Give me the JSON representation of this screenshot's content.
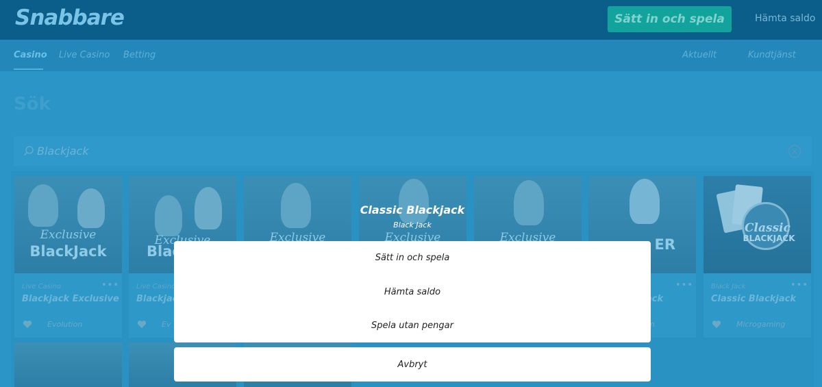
{
  "header": {
    "logo": "Snabbare",
    "deposit_button": "Sätt in och spela",
    "fetch_balance": "Hämta saldo"
  },
  "nav": {
    "left": [
      "Casino",
      "Live Casino",
      "Betting"
    ],
    "right": [
      "Aktuellt",
      "Kundtjänst"
    ]
  },
  "search": {
    "title": "Sök",
    "query": "Blackjack"
  },
  "cards": [
    {
      "overlay": "Exclusive",
      "overlay2": "BlackJack",
      "category": "Live Casino",
      "title": "Blackjack Exclusive",
      "provider": "Evolution"
    },
    {
      "overlay": "Exclusive",
      "overlay2": "Blac",
      "category": "Live Casino",
      "title": "Blackjac",
      "provider": "Ev"
    },
    {
      "overlay": "Exclusive",
      "overlay2": "",
      "category": "",
      "title": "",
      "provider": ""
    },
    {
      "overlay": "Exclusive",
      "overlay2": "",
      "category": "",
      "title": "",
      "provider": ""
    },
    {
      "overlay": "Exclusive",
      "overlay2": "",
      "category": "",
      "title": "",
      "provider": ""
    },
    {
      "overlay": "",
      "overlay2": "ER",
      "category": "",
      "title": "ack",
      "provider": "n"
    },
    {
      "overlay": "Classic",
      "overlay2": "BLACKJACK",
      "category": "Black Jack",
      "title": "Classic Blackjack",
      "provider": "Microgaming"
    }
  ],
  "modal": {
    "title": "Classic Blackjack",
    "subtitle": "Black Jack",
    "actions": [
      "Sätt in och spela",
      "Hämta saldo",
      "Spela utan pengar"
    ],
    "cancel": "Avbryt"
  }
}
